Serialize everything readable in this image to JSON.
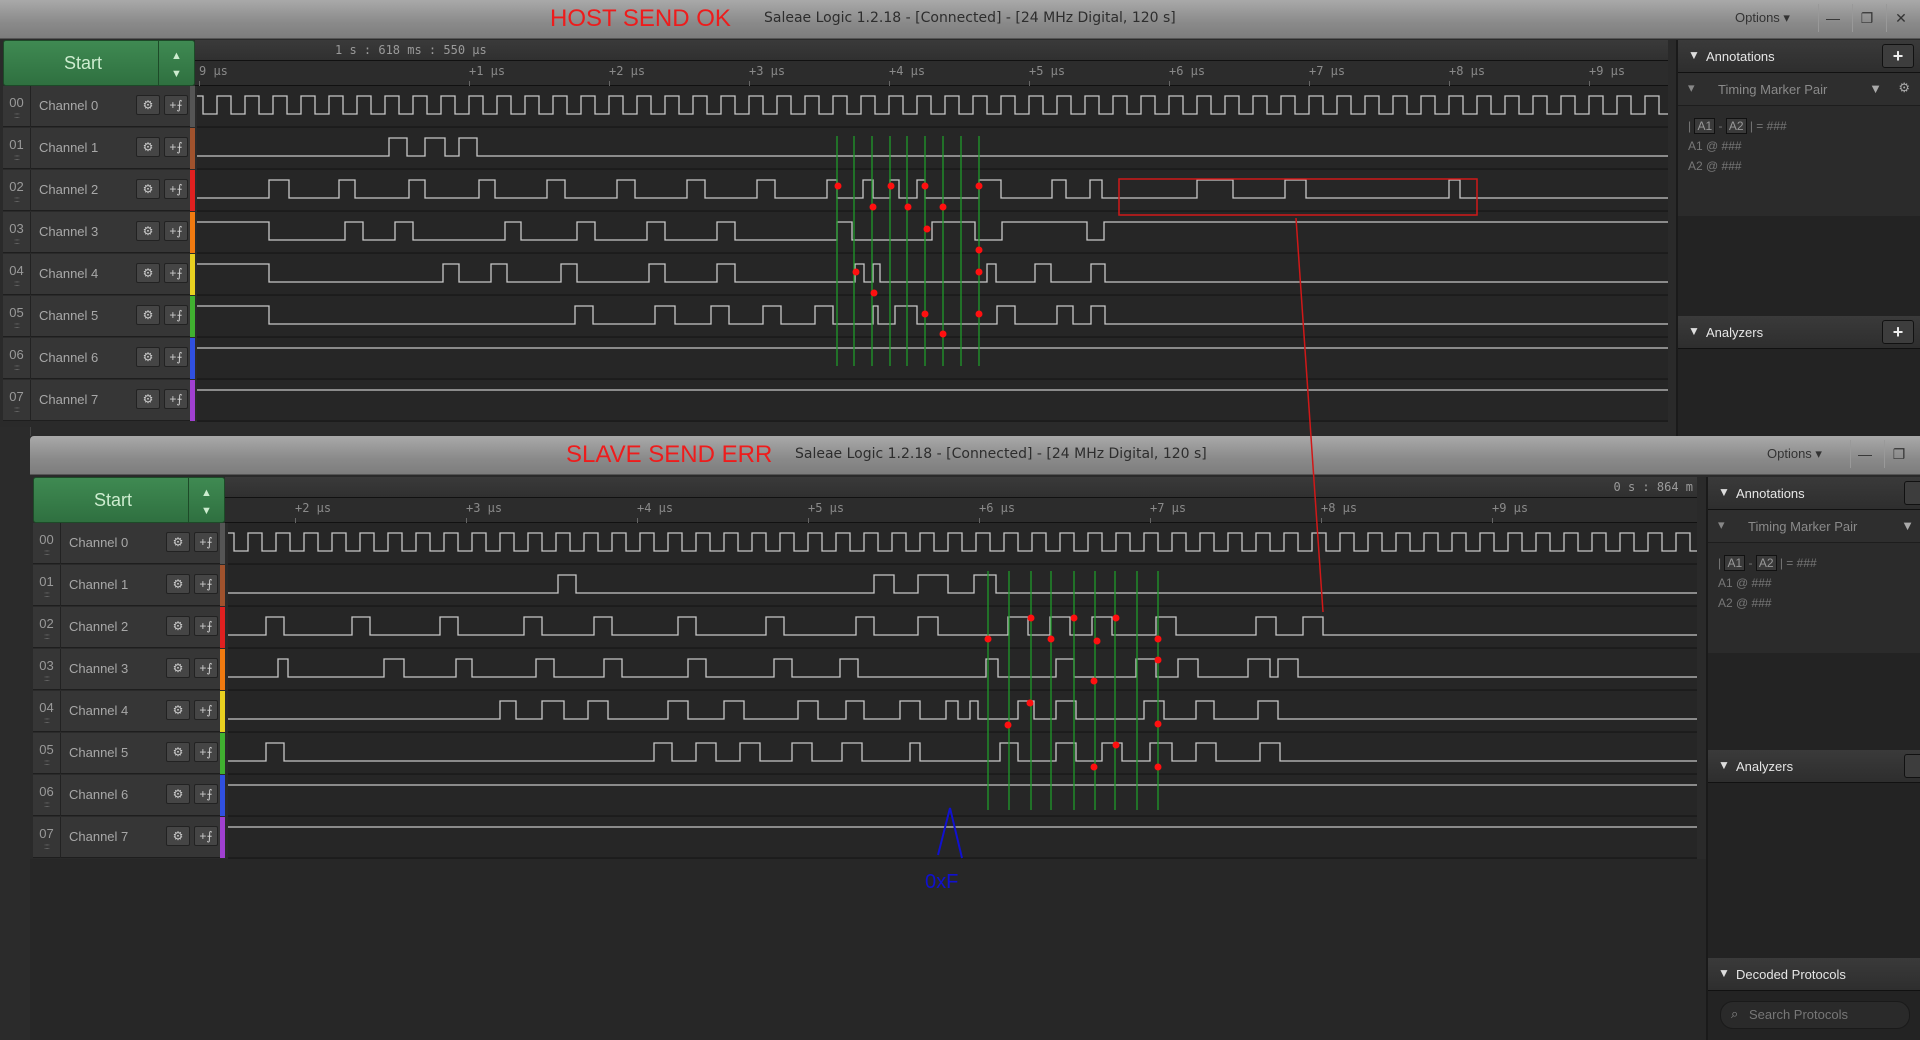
{
  "windows": [
    {
      "id": "host",
      "overlay_label": "HOST SEND OK",
      "title": "Saleae Logic 1.2.18 - [Connected] - [24 MHz Digital, 120 s]",
      "options_label": "Options ▾",
      "start_label": "Start",
      "timestamp": "1 s : 618 ms : 550 µs",
      "ruler_ticks": [
        "9 µs",
        "+1 µs",
        "+2 µs",
        "+3 µs",
        "+4 µs",
        "+5 µs",
        "+6 µs",
        "+7 µs",
        "+8 µs",
        "+9 µs"
      ],
      "channels": [
        {
          "num": "00",
          "name": "Channel 0",
          "color": "#555555"
        },
        {
          "num": "01",
          "name": "Channel 1",
          "color": "#a0522d"
        },
        {
          "num": "02",
          "name": "Channel 2",
          "color": "#e02020"
        },
        {
          "num": "03",
          "name": "Channel 3",
          "color": "#f07a10"
        },
        {
          "num": "04",
          "name": "Channel 4",
          "color": "#e8d020"
        },
        {
          "num": "05",
          "name": "Channel 5",
          "color": "#40b030"
        },
        {
          "num": "06",
          "name": "Channel 6",
          "color": "#3050e0"
        },
        {
          "num": "07",
          "name": "Channel 7",
          "color": "#a040d0"
        }
      ],
      "annotations": {
        "title": "Annotations",
        "marker_type": "Timing Marker Pair",
        "diff_label": "= ###",
        "a1_label": "A1",
        "a2_label": "A2",
        "a1_value": "@  ###",
        "a2_value": "@  ###"
      },
      "analyzers_title": "Analyzers"
    },
    {
      "id": "slave",
      "overlay_label": "SLAVE SEND ERR",
      "title": "Saleae Logic 1.2.18 - [Connected] - [24 MHz Digital, 120 s]",
      "options_label": "Options ▾",
      "start_label": "Start",
      "timestamp": "0 s : 864 m",
      "ruler_ticks": [
        "+2 µs",
        "+3 µs",
        "+4 µs",
        "+5 µs",
        "+6 µs",
        "+7 µs",
        "+8 µs",
        "+9 µs"
      ],
      "channels": [
        {
          "num": "00",
          "name": "Channel 0",
          "color": "#555555"
        },
        {
          "num": "01",
          "name": "Channel 1",
          "color": "#a0522d"
        },
        {
          "num": "02",
          "name": "Channel 2",
          "color": "#e02020"
        },
        {
          "num": "03",
          "name": "Channel 3",
          "color": "#f07a10"
        },
        {
          "num": "04",
          "name": "Channel 4",
          "color": "#e8d020"
        },
        {
          "num": "05",
          "name": "Channel 5",
          "color": "#40b030"
        },
        {
          "num": "06",
          "name": "Channel 6",
          "color": "#3050e0"
        },
        {
          "num": "07",
          "name": "Channel 7",
          "color": "#a040d0"
        }
      ],
      "annotations": {
        "title": "Annotations",
        "marker_type": "Timing Marker Pair",
        "diff_label": "= ###",
        "a1_label": "A1",
        "a2_label": "A2",
        "a1_value": "@  ###",
        "a2_value": "@  ###"
      },
      "analyzers_title": "Analyzers",
      "decoded_title": "Decoded Protocols",
      "search_placeholder": "Search Protocols"
    }
  ],
  "hand_annotation": {
    "text": "0xF",
    "color": "#1010d0"
  },
  "colors": {
    "accent_start": "#2f7040",
    "marker_dot": "#ff1010",
    "marker_line": "#1f9a2a",
    "highlight_box": "#d01818"
  }
}
